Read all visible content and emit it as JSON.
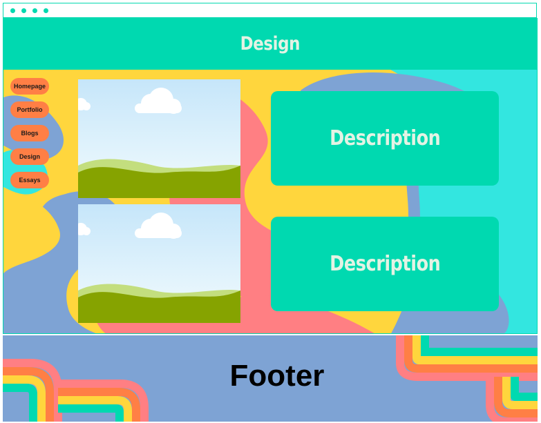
{
  "header": {
    "title": "Design"
  },
  "nav": {
    "items": [
      {
        "label": "Homepage"
      },
      {
        "label": "Portfolio"
      },
      {
        "label": "Blogs"
      },
      {
        "label": "Design"
      },
      {
        "label": "Essays"
      }
    ]
  },
  "cards": [
    {
      "image_icon": "landscape-image-placeholder",
      "description": "Description"
    },
    {
      "image_icon": "landscape-image-placeholder",
      "description": "Description"
    }
  ],
  "footer": {
    "text": "Footer"
  },
  "colors": {
    "teal": "#00d9b0",
    "orange_button": "#ff7f45",
    "yellow": "#ffd63d",
    "pink": "#ff7f83",
    "blue": "#7ea3d4",
    "cyan": "#33e6e0",
    "title_text": "#e3f3e4"
  }
}
